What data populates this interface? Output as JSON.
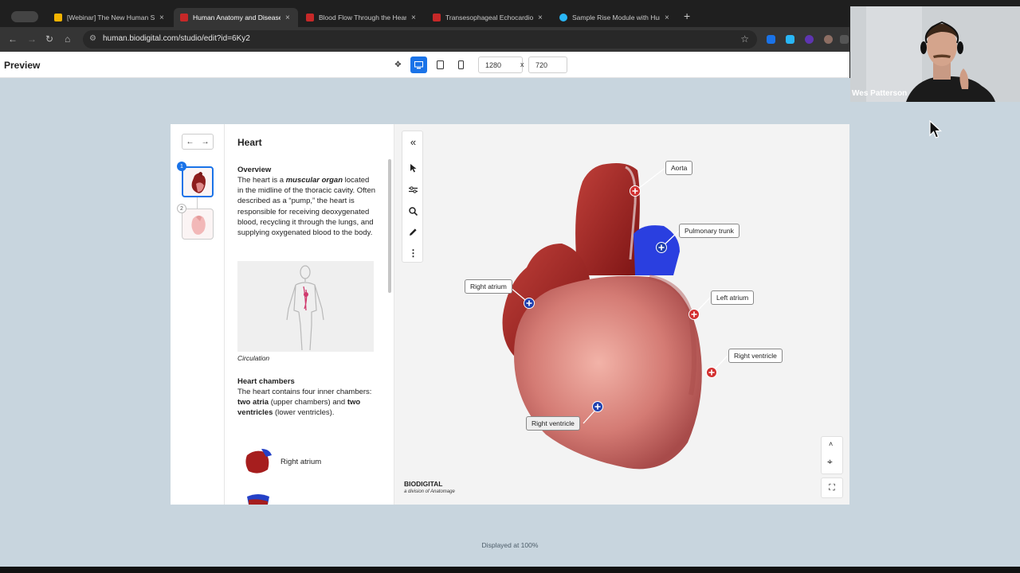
{
  "browser": {
    "tabs": [
      {
        "label": "[Webinar] The New Human St",
        "favicon_color": "#f4b400"
      },
      {
        "label": "Human Anatomy and Disease",
        "favicon_color": "#c62828",
        "active": true
      },
      {
        "label": "Blood Flow Through the Hear",
        "favicon_color": "#c62828"
      },
      {
        "label": "Transesophageal Echocardio",
        "favicon_color": "#c62828"
      },
      {
        "label": "Sample Rise Module with Hur",
        "favicon_color": "#29b6f6"
      }
    ],
    "close_glyph": "×",
    "new_tab_glyph": "+",
    "url": "human.biodigital.com/studio/edit?id=6Ky2",
    "nav_icons": [
      "back-arrow-icon",
      "forward-arrow-icon",
      "reload-icon",
      "home-icon"
    ]
  },
  "preview": {
    "title": "Preview",
    "width_value": "1280",
    "height_value": "720",
    "times": "x",
    "accent": "#1a73e8"
  },
  "module": {
    "nav": {
      "prev": "←",
      "next": "→"
    },
    "thumbs": [
      {
        "number": "1"
      },
      {
        "number": "2"
      }
    ],
    "title": "Heart",
    "overview_heading": "Overview",
    "overview_p1": "The heart is a ",
    "overview_bold": "muscular organ",
    "overview_p2": " located in the midline of the thoracic cavity. Often described as a “pump,” the heart is responsible for receiving deoxygenated blood, recycling it through the lungs, and supplying oxygenated blood to the body.",
    "image_caption": "Circulation",
    "chambers_heading": "Heart chambers",
    "chambers_p1": "The heart contains four inner chambers: ",
    "chambers_b1": "two atria",
    "chambers_p2": " (upper chambers) and ",
    "chambers_b2": "two ventricles",
    "chambers_p3": " (lower ventricles).",
    "list_items": [
      {
        "label": "Right atrium"
      },
      {
        "label": ""
      }
    ]
  },
  "viewer": {
    "labels": {
      "aorta": "Aorta",
      "pulmonary_trunk": "Pulmonary trunk",
      "right_atrium": "Right atrium",
      "left_atrium": "Left atrium",
      "right_ventricle_1": "Right ventricle",
      "right_ventricle_2": "Right ventricle"
    },
    "logo": "BIODIGITAL",
    "logo_sub": "a division of Anatomage",
    "marker_red": "#d32f2f",
    "marker_blue": "#1e3fae"
  },
  "footer": {
    "displayed": "Displayed at 100%"
  },
  "webcam": {
    "name": "Wes Patterson"
  }
}
